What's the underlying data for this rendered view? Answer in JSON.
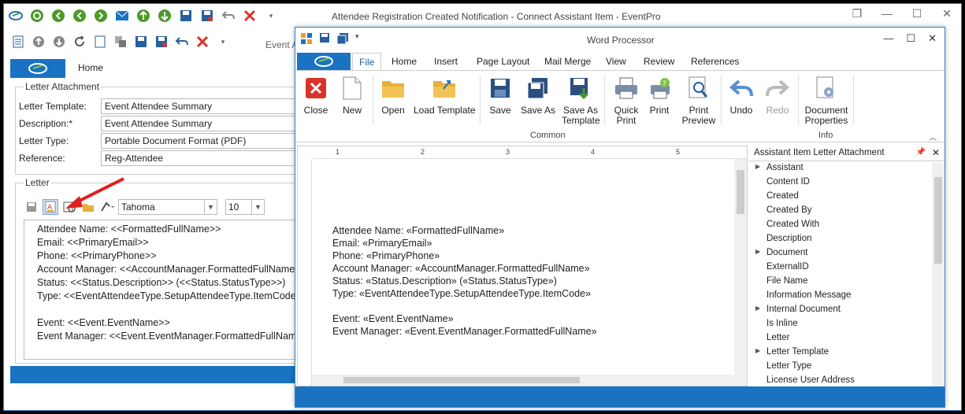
{
  "main_window": {
    "title": "Attendee Registration Created Notification - Connect Assistant Item - EventPro",
    "home_tab": "Home",
    "event_tab_partial": "Event A",
    "letter_attachment": {
      "legend": "Letter Attachment",
      "fields": [
        {
          "label": "Letter Template:",
          "value": "Event Attendee Summary"
        },
        {
          "label": "Description:*",
          "value": "Event Attendee Summary"
        },
        {
          "label": "Letter Type:",
          "value": "Portable Document Format (PDF)"
        },
        {
          "label": "Reference:",
          "value": "Reg-Attendee"
        }
      ]
    },
    "letter": {
      "legend": "Letter",
      "font": "Tahoma",
      "size": "10",
      "lines": [
        "Attendee Name: <<FormattedFullName>>",
        "Email: <<PrimaryEmail>>",
        "Phone: <<PrimaryPhone>>",
        "Account Manager: <<AccountManager.FormattedFullName>>",
        "Status: <<Status.Description>> (<<Status.StatusType>>)",
        "Type: <<EventAttendeeType.SetupAttendeeType.ItemCode>>",
        "",
        "Event: <<Event.EventName>>",
        "Event Manager:  <<Event.EventManager.FormattedFullName>>"
      ]
    }
  },
  "word_processor": {
    "title": "Word Processor",
    "tabs": [
      "File",
      "Home",
      "Insert",
      "Page Layout",
      "Mail Merge",
      "View",
      "Review",
      "References"
    ],
    "ribbon": {
      "close": "Close",
      "new": "New",
      "open": "Open",
      "load_template": "Load Template",
      "save": "Save",
      "save_as": "Save As",
      "save_as_template": "Save As Template",
      "quick_print": "Quick Print",
      "print": "Print",
      "print_preview": "Print Preview",
      "undo": "Undo",
      "redo": "Redo",
      "doc_props": "Document Properties",
      "group_common": "Common",
      "group_info": "Info"
    },
    "ruler": [
      "1",
      "2",
      "3",
      "4",
      "5"
    ],
    "document_lines": [
      "Attendee Name: «FormattedFullName»",
      "Email: «PrimaryEmail»",
      "Phone: «PrimaryPhone»",
      "Account Manager: «AccountManager.FormattedFullName»",
      "Status: «Status.Description» («Status.StatusType»)",
      "Type: «EventAttendeeType.SetupAttendeeType.ItemCode»",
      "",
      "Event: «Event.EventName»",
      "Event Manager:  «Event.EventManager.FormattedFullName»"
    ],
    "panel": {
      "title": "Assistant Item Letter Attachment",
      "items": [
        {
          "label": "Assistant",
          "expandable": true
        },
        {
          "label": "Content ID",
          "expandable": false
        },
        {
          "label": "Created",
          "expandable": false
        },
        {
          "label": "Created By",
          "expandable": false
        },
        {
          "label": "Created With",
          "expandable": false
        },
        {
          "label": "Description",
          "expandable": false
        },
        {
          "label": "Document",
          "expandable": true
        },
        {
          "label": "ExternalID",
          "expandable": false
        },
        {
          "label": "File Name",
          "expandable": false
        },
        {
          "label": "Information Message",
          "expandable": false
        },
        {
          "label": "Internal Document",
          "expandable": true
        },
        {
          "label": "Is Inline",
          "expandable": false
        },
        {
          "label": "Letter",
          "expandable": false
        },
        {
          "label": "Letter Template",
          "expandable": true
        },
        {
          "label": "Letter Type",
          "expandable": false
        },
        {
          "label": "License User Address",
          "expandable": false
        }
      ]
    }
  },
  "colors": {
    "accent": "#1a73c2",
    "close_red": "#d9342b",
    "green_nav": "#4a9a2a"
  }
}
